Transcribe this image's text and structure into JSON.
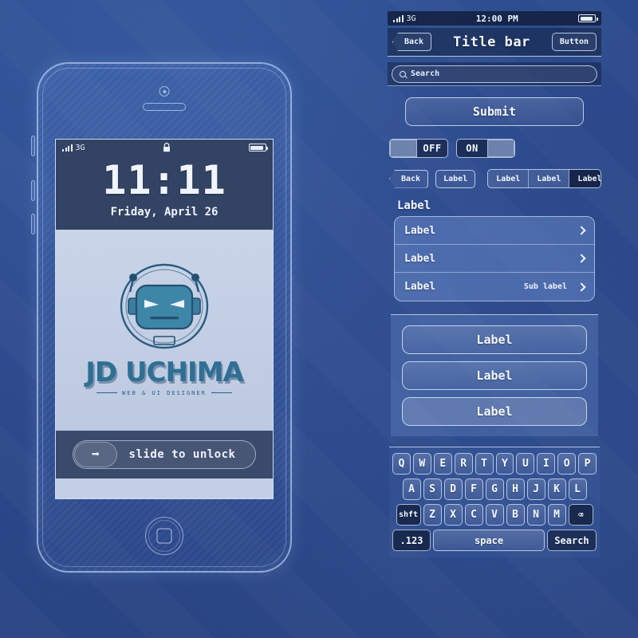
{
  "phone": {
    "status": {
      "carrier": "3G",
      "lock_icon": "lock-icon",
      "signal_icon": "signal-bars-icon",
      "battery_icon": "battery-icon"
    },
    "lockscreen": {
      "time": "11:11",
      "date": "Friday, April 26"
    },
    "wallpaper": {
      "logo_name": "JD UCHIMA",
      "logo_tagline": "WEB & UI DESIGNER",
      "robot_icon": "robot-head-icon"
    },
    "unlock": {
      "label": "slide to unlock",
      "arrow_icon": "arrow-right-icon"
    },
    "hardware": {
      "camera_icon": "front-camera-icon",
      "speaker_icon": "earpiece-speaker-icon",
      "home_icon": "home-button-icon"
    }
  },
  "kit": {
    "status": {
      "carrier": "3G",
      "time": "12:00 PM",
      "signal_icon": "signal-bars-icon",
      "battery_icon": "battery-icon"
    },
    "titlebar": {
      "back": "Back",
      "title": "Title bar",
      "button": "Button"
    },
    "search": {
      "placeholder": "Search",
      "icon": "search-icon"
    },
    "submit": {
      "label": "Submit"
    },
    "toggles": [
      {
        "label": "OFF",
        "state": "off"
      },
      {
        "label": "ON",
        "state": "on"
      }
    ],
    "buttons_row": {
      "back": "Back",
      "label": "Label"
    },
    "segmented": {
      "options": [
        "Label",
        "Label",
        "Label"
      ],
      "selected_index": 2
    },
    "list": {
      "section_label": "Label",
      "rows": [
        {
          "label": "Label",
          "sub": "",
          "chevron": "chevron-right-icon"
        },
        {
          "label": "Label",
          "sub": "",
          "chevron": "chevron-right-icon"
        },
        {
          "label": "Label",
          "sub": "Sub label",
          "chevron": "chevron-right-icon"
        }
      ]
    },
    "panel_buttons": [
      "Label",
      "Label",
      "Label"
    ],
    "keyboard": {
      "row1": [
        "Q",
        "W",
        "E",
        "R",
        "T",
        "Y",
        "U",
        "I",
        "O",
        "P"
      ],
      "row2": [
        "A",
        "S",
        "D",
        "F",
        "G",
        "H",
        "J",
        "K",
        "L"
      ],
      "row3": [
        "Z",
        "X",
        "C",
        "V",
        "B",
        "N",
        "M"
      ],
      "shift": "shft",
      "delete": "⌫",
      "numbers": ".123",
      "space": "space",
      "search": "Search"
    }
  },
  "colors": {
    "background": "#2c4e92",
    "accent_line": "#d7e8ff",
    "panel": "#7da0dc",
    "dark_fill": "#101c38",
    "screen_bg": "#c3cfe4",
    "lock_bar": "#334363"
  }
}
